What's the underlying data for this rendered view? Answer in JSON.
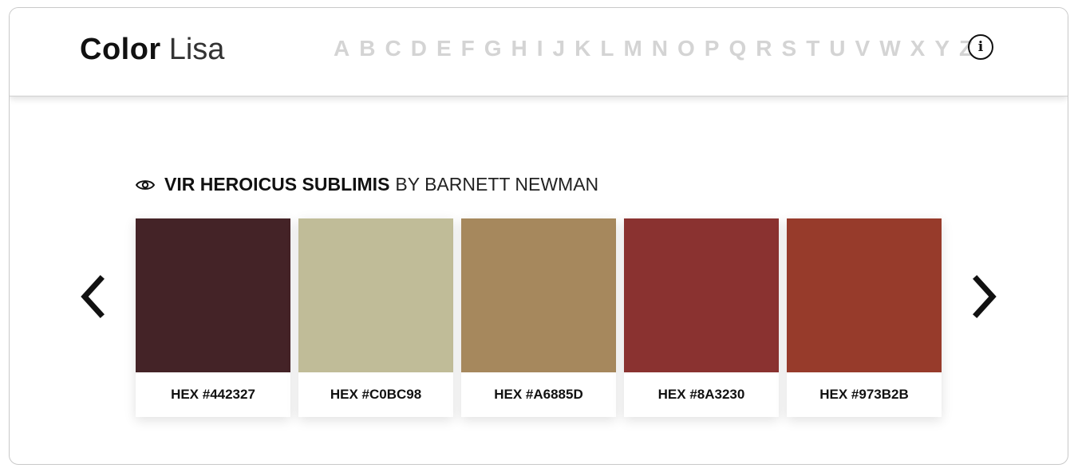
{
  "header": {
    "logo_bold": "Color",
    "logo_light": "Lisa",
    "alphabet": [
      "A",
      "B",
      "C",
      "D",
      "E",
      "F",
      "G",
      "H",
      "I",
      "J",
      "K",
      "L",
      "M",
      "N",
      "O",
      "P",
      "Q",
      "R",
      "S",
      "T",
      "U",
      "V",
      "W",
      "X",
      "Y",
      "Z"
    ],
    "info_icon": "i"
  },
  "painting": {
    "title": "VIR HEROICUS SUBLIMIS",
    "by_artist": "BY BARNETT NEWMAN"
  },
  "swatches": [
    {
      "color": "#442327",
      "label": "HEX #442327"
    },
    {
      "color": "#C0BC98",
      "label": "HEX #C0BC98"
    },
    {
      "color": "#A6885D",
      "label": "HEX #A6885D"
    },
    {
      "color": "#8A3230",
      "label": "HEX #8A3230"
    },
    {
      "color": "#973B2B",
      "label": "HEX #973B2B"
    }
  ],
  "icons": {
    "eye": "eye-icon",
    "prev": "chevron-left-icon",
    "next": "chevron-right-icon",
    "info": "info-icon"
  }
}
